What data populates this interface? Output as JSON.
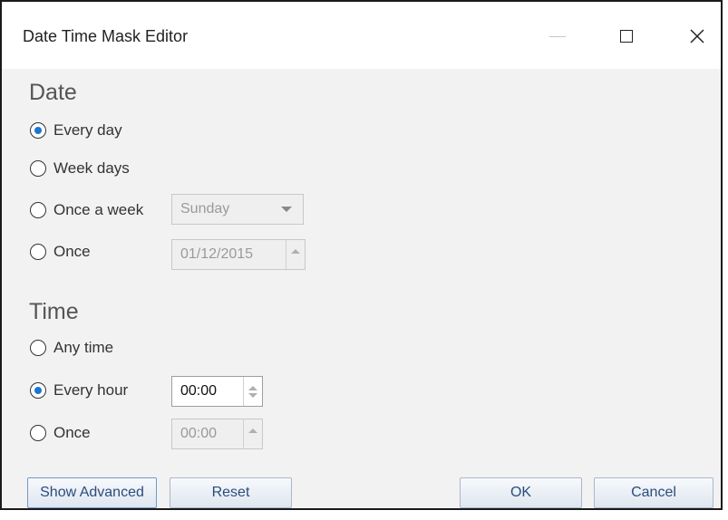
{
  "window": {
    "title": "Date Time Mask Editor"
  },
  "date": {
    "heading": "Date",
    "options": [
      {
        "label": "Every day",
        "checked": true
      },
      {
        "label": "Week days",
        "checked": false
      },
      {
        "label": "Once a week",
        "checked": false
      },
      {
        "label": "Once",
        "checked": false
      }
    ],
    "weekday_select": {
      "value": "Sunday",
      "enabled": false
    },
    "once_date": {
      "value": "01/12/2015",
      "enabled": false
    }
  },
  "time": {
    "heading": "Time",
    "options": [
      {
        "label": "Any time",
        "checked": false
      },
      {
        "label": "Every hour",
        "checked": true
      },
      {
        "label": "Once",
        "checked": false
      }
    ],
    "every_hour_time": {
      "value": "00:00",
      "enabled": true
    },
    "once_time": {
      "value": "00:00",
      "enabled": false
    }
  },
  "buttons": {
    "show_advanced": "Show Advanced",
    "reset": "Reset",
    "ok": "OK",
    "cancel": "Cancel"
  },
  "colors": {
    "accent": "#1976d2",
    "button_text": "#2a4d7c"
  }
}
